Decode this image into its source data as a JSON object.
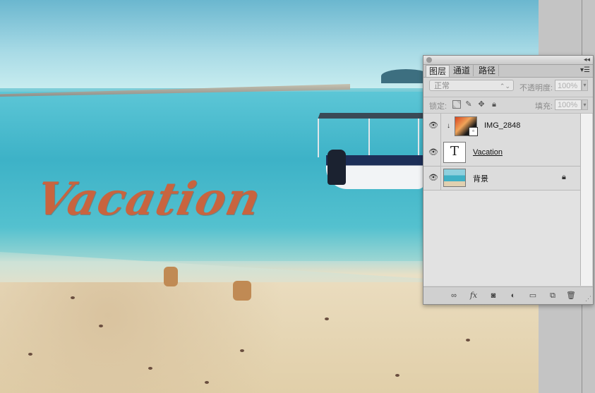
{
  "canvas": {
    "artwork_text": "Vacation"
  },
  "layers_panel": {
    "tabs": [
      "图层",
      "通道",
      "路径"
    ],
    "blend_mode": "正常",
    "opacity_label": "不透明度:",
    "opacity_value": "100%",
    "lock_label": "锁定:",
    "fill_label": "填充:",
    "fill_value": "100%",
    "layers": [
      {
        "name": "IMG_2848",
        "type": "smart-object",
        "clipped": true,
        "visible": true
      },
      {
        "name": "Vacation",
        "type": "text",
        "thumb_glyph": "T",
        "visible": true
      },
      {
        "name": "背景",
        "type": "background",
        "locked": true,
        "visible": true
      }
    ],
    "icons": {
      "close": "close-icon",
      "collapse": "collapse-icon",
      "menu": "panel-menu-icon",
      "eye": "eye-icon",
      "lock": "lock-icon",
      "link": "link-icon",
      "fx": "fx-icon",
      "mask": "mask-icon",
      "adjustment": "adjustment-icon",
      "group": "folder-icon",
      "new_layer": "new-layer-icon",
      "trash": "trash-icon"
    },
    "footer": {
      "fx_label": "fx"
    }
  }
}
